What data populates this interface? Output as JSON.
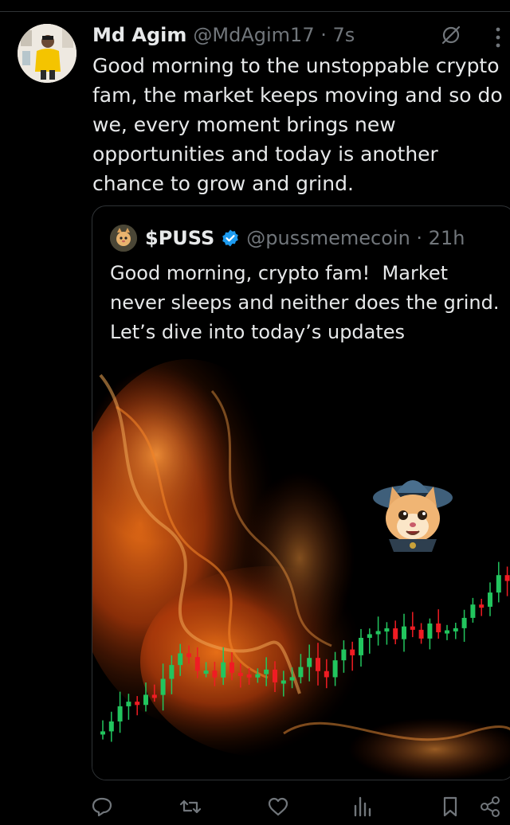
{
  "tweet": {
    "author_name": "Md Agim",
    "author_handle": "@MdAgim17 · 7s",
    "text": "Good morning to the unstoppable crypto fam, the market keeps moving and so do we, every moment brings new opportunities and today is another chance to grow and grind."
  },
  "quoted": {
    "name": "$PUSS",
    "handle": "@pussmemecoin · 21h",
    "text": "Good morning, crypto fam!  Market never sleeps and neither does the grind. Let’s dive into today’s updates"
  },
  "colors": {
    "background": "#000000",
    "text": "#e7e9ea",
    "muted": "#71767b",
    "verified": "#1d9bf0",
    "candle_up": "#22c55e",
    "candle_down": "#ef1c23"
  },
  "icons": {
    "header": [
      "grok-icon",
      "more-icon"
    ],
    "actions": [
      "reply-icon",
      "retweet-icon",
      "like-icon",
      "views-icon",
      "bookmark-icon",
      "share-icon"
    ]
  }
}
